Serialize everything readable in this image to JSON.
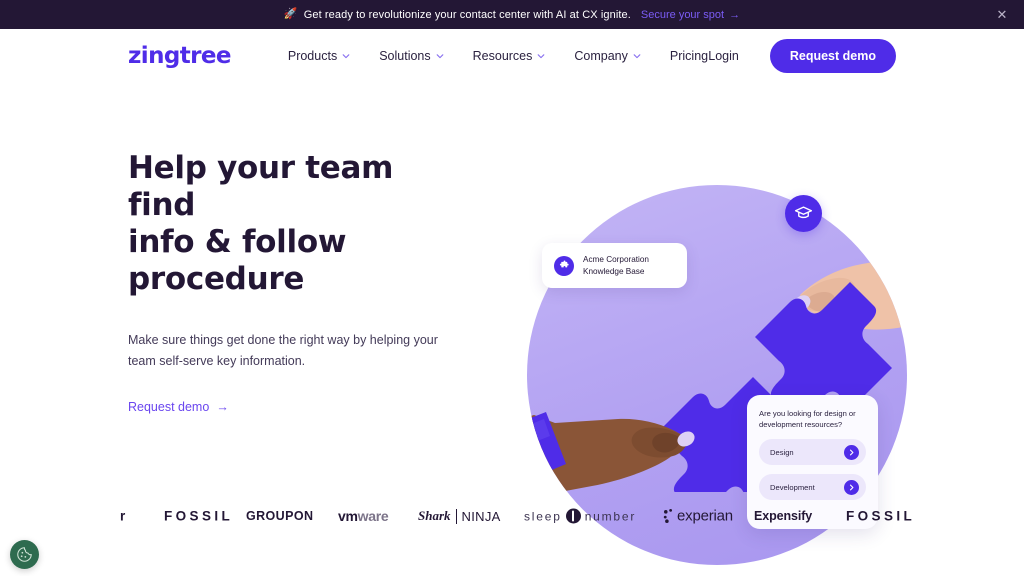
{
  "announcement": {
    "icon": "rocket-icon",
    "text": "Get ready to revolutionize your contact center with AI at CX ignite.",
    "link_label": "Secure your spot",
    "link_arrow": "→",
    "close_label": "✕",
    "bg_color": "#231735",
    "link_color": "#7b5cf5"
  },
  "nav": {
    "logo": "zingtree",
    "items": [
      {
        "label": "Products",
        "has_chevron": true
      },
      {
        "label": "Solutions",
        "has_chevron": true
      },
      {
        "label": "Resources",
        "has_chevron": true
      },
      {
        "label": "Company",
        "has_chevron": true
      },
      {
        "label": "Pricing",
        "has_chevron": false
      }
    ],
    "login_label": "Login",
    "demo_label": "Request demo",
    "accent_color": "#4f2ce8"
  },
  "hero": {
    "title_lines": [
      "Help your team find",
      "info & follow",
      "procedure"
    ],
    "title": "Help your team find info & follow procedure",
    "subtitle": "Make sure things get done the right way by helping your team self-serve key information.",
    "cta_label": "Request demo",
    "cta_arrow": "→",
    "title_color": "#231735",
    "circle_color": "#b2a1f2"
  },
  "hero_art": {
    "badge_icon": "graduation-cap-icon",
    "kb_card": {
      "icon": "puzzle-piece-icon",
      "line1": "Acme Corporation",
      "line2": "Knowledge Base"
    },
    "chat_card": {
      "question": "Are you looking for design or development resources?",
      "options": [
        {
          "label": "Design"
        },
        {
          "label": "Development"
        }
      ],
      "arrow_icon": "chevron-right-icon"
    }
  },
  "logos": [
    {
      "name": "fossil-clipped",
      "text": "r",
      "style": "clip"
    },
    {
      "name": "fossil",
      "text": "FOSSIL",
      "style": "fossil"
    },
    {
      "name": "groupon",
      "text": "GROUPON",
      "style": "groupon"
    },
    {
      "name": "vmware",
      "text": "vmware",
      "text_bold": "vm",
      "text_light": "ware",
      "style": "vmware"
    },
    {
      "name": "sharkninja",
      "text": "Shark NINJA",
      "text_bold": "Shark",
      "text_light": "NINJA",
      "style": "shark"
    },
    {
      "name": "sleep-number",
      "text": "sleep number",
      "text_left": "sleep",
      "text_right": "number",
      "style": "sleep"
    },
    {
      "name": "experian",
      "text": "experian",
      "style": "experian"
    },
    {
      "name": "expensify",
      "text": "Expensify",
      "style": "expensify"
    },
    {
      "name": "fossil-2",
      "text": "FOSSIL",
      "style": "fossil"
    }
  ],
  "cookie": {
    "icon": "cookie-icon",
    "color": "#2e6b4f"
  }
}
